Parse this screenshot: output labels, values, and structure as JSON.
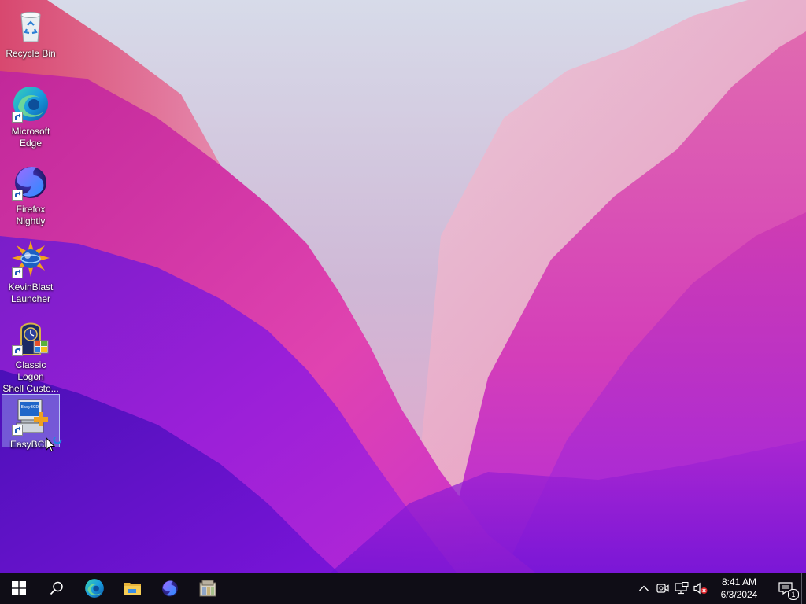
{
  "desktop": {
    "icons": [
      {
        "label": "Recycle Bin",
        "icon": "recycle-bin-icon",
        "shortcut": false,
        "selected": false
      },
      {
        "label": "Microsoft\nEdge",
        "icon": "edge-icon",
        "shortcut": true,
        "selected": false
      },
      {
        "label": "Firefox\nNightly",
        "icon": "firefox-nightly-icon",
        "shortcut": true,
        "selected": false
      },
      {
        "label": "KevinBlast\nLauncher",
        "icon": "kevinblast-icon",
        "shortcut": true,
        "selected": false
      },
      {
        "label": "Classic Logon\nShell Custo...",
        "icon": "classic-logon-icon",
        "shortcut": true,
        "selected": false
      },
      {
        "label": "EasyBCD",
        "icon": "easybcd-icon",
        "shortcut": true,
        "selected": true
      }
    ]
  },
  "taskbar": {
    "start": {
      "icon": "windows-logo-icon"
    },
    "search": {
      "icon": "search-icon"
    },
    "pinned": [
      {
        "icon": "edge-icon"
      },
      {
        "icon": "file-explorer-icon"
      },
      {
        "icon": "firefox-nightly-icon"
      },
      {
        "icon": "archive-app-icon"
      }
    ],
    "tray": {
      "icons": [
        "chevron-up-icon",
        "meet-now-icon",
        "network-icon",
        "volume-muted-icon"
      ],
      "time": "8:41 AM",
      "date": "6/3/2024",
      "notification_count": "1"
    }
  },
  "colors": {
    "taskbar_bg": "#0f0d16",
    "selection": "#aacdff"
  }
}
